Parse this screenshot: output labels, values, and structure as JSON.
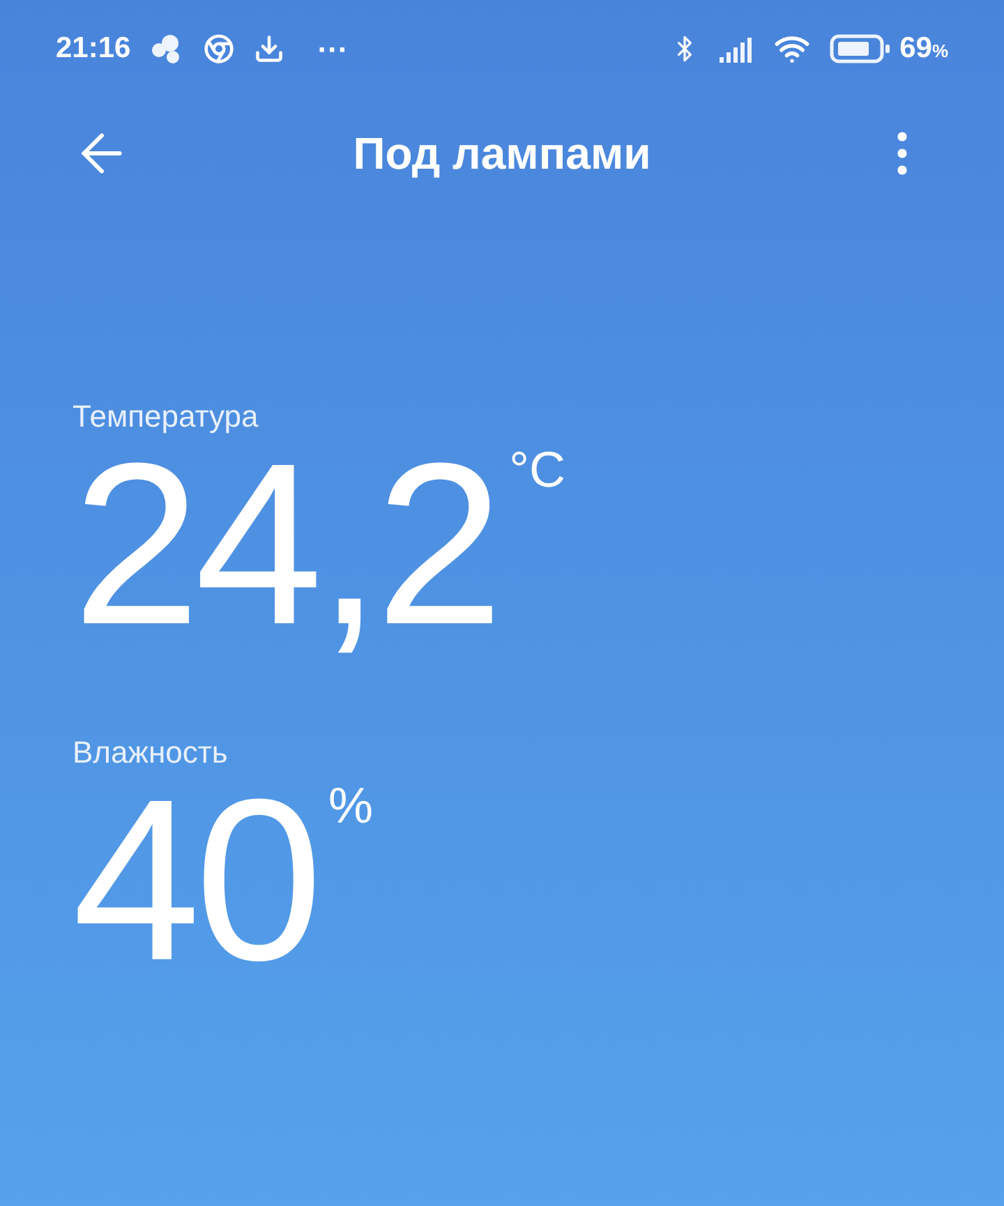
{
  "status_bar": {
    "time": "21:16",
    "more": "···",
    "battery_percent": "69",
    "battery_unit": "%"
  },
  "header": {
    "title": "Под лампами"
  },
  "readings": [
    {
      "label": "Температура",
      "value": "24,2",
      "unit": "°C"
    },
    {
      "label": "Влажность",
      "value": "40",
      "unit": "%"
    }
  ]
}
